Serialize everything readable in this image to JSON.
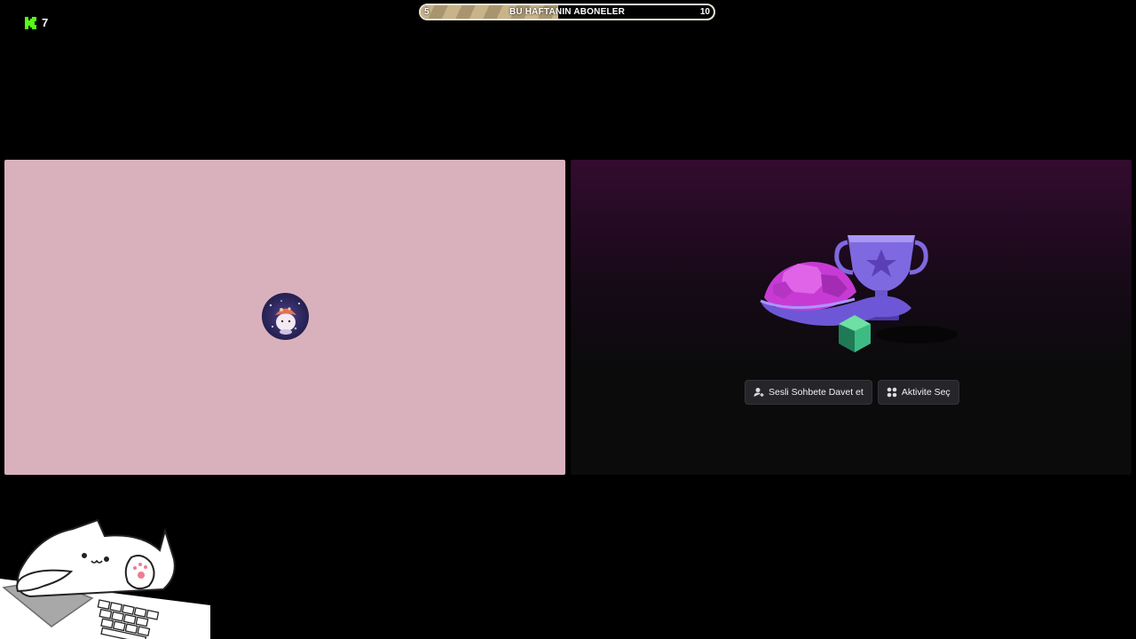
{
  "overlay": {
    "viewer_count": "7"
  },
  "sub_goal": {
    "title": "BU HAFTANIN ABONELER",
    "min": "5",
    "max": "10",
    "progress": 0.47
  },
  "activity": {
    "invite_label": "Sesli Sohbete Davet et",
    "choose_activity_label": "Aktivite Seç"
  },
  "colors": {
    "kick_green": "#53fc18",
    "tile_pink": "#d9b1bd",
    "goal_fill": "#c9b48a"
  },
  "icons": [
    "kick-logo-icon",
    "user-avatar",
    "add-person-icon",
    "apps-grid-icon",
    "bongo-cat"
  ]
}
